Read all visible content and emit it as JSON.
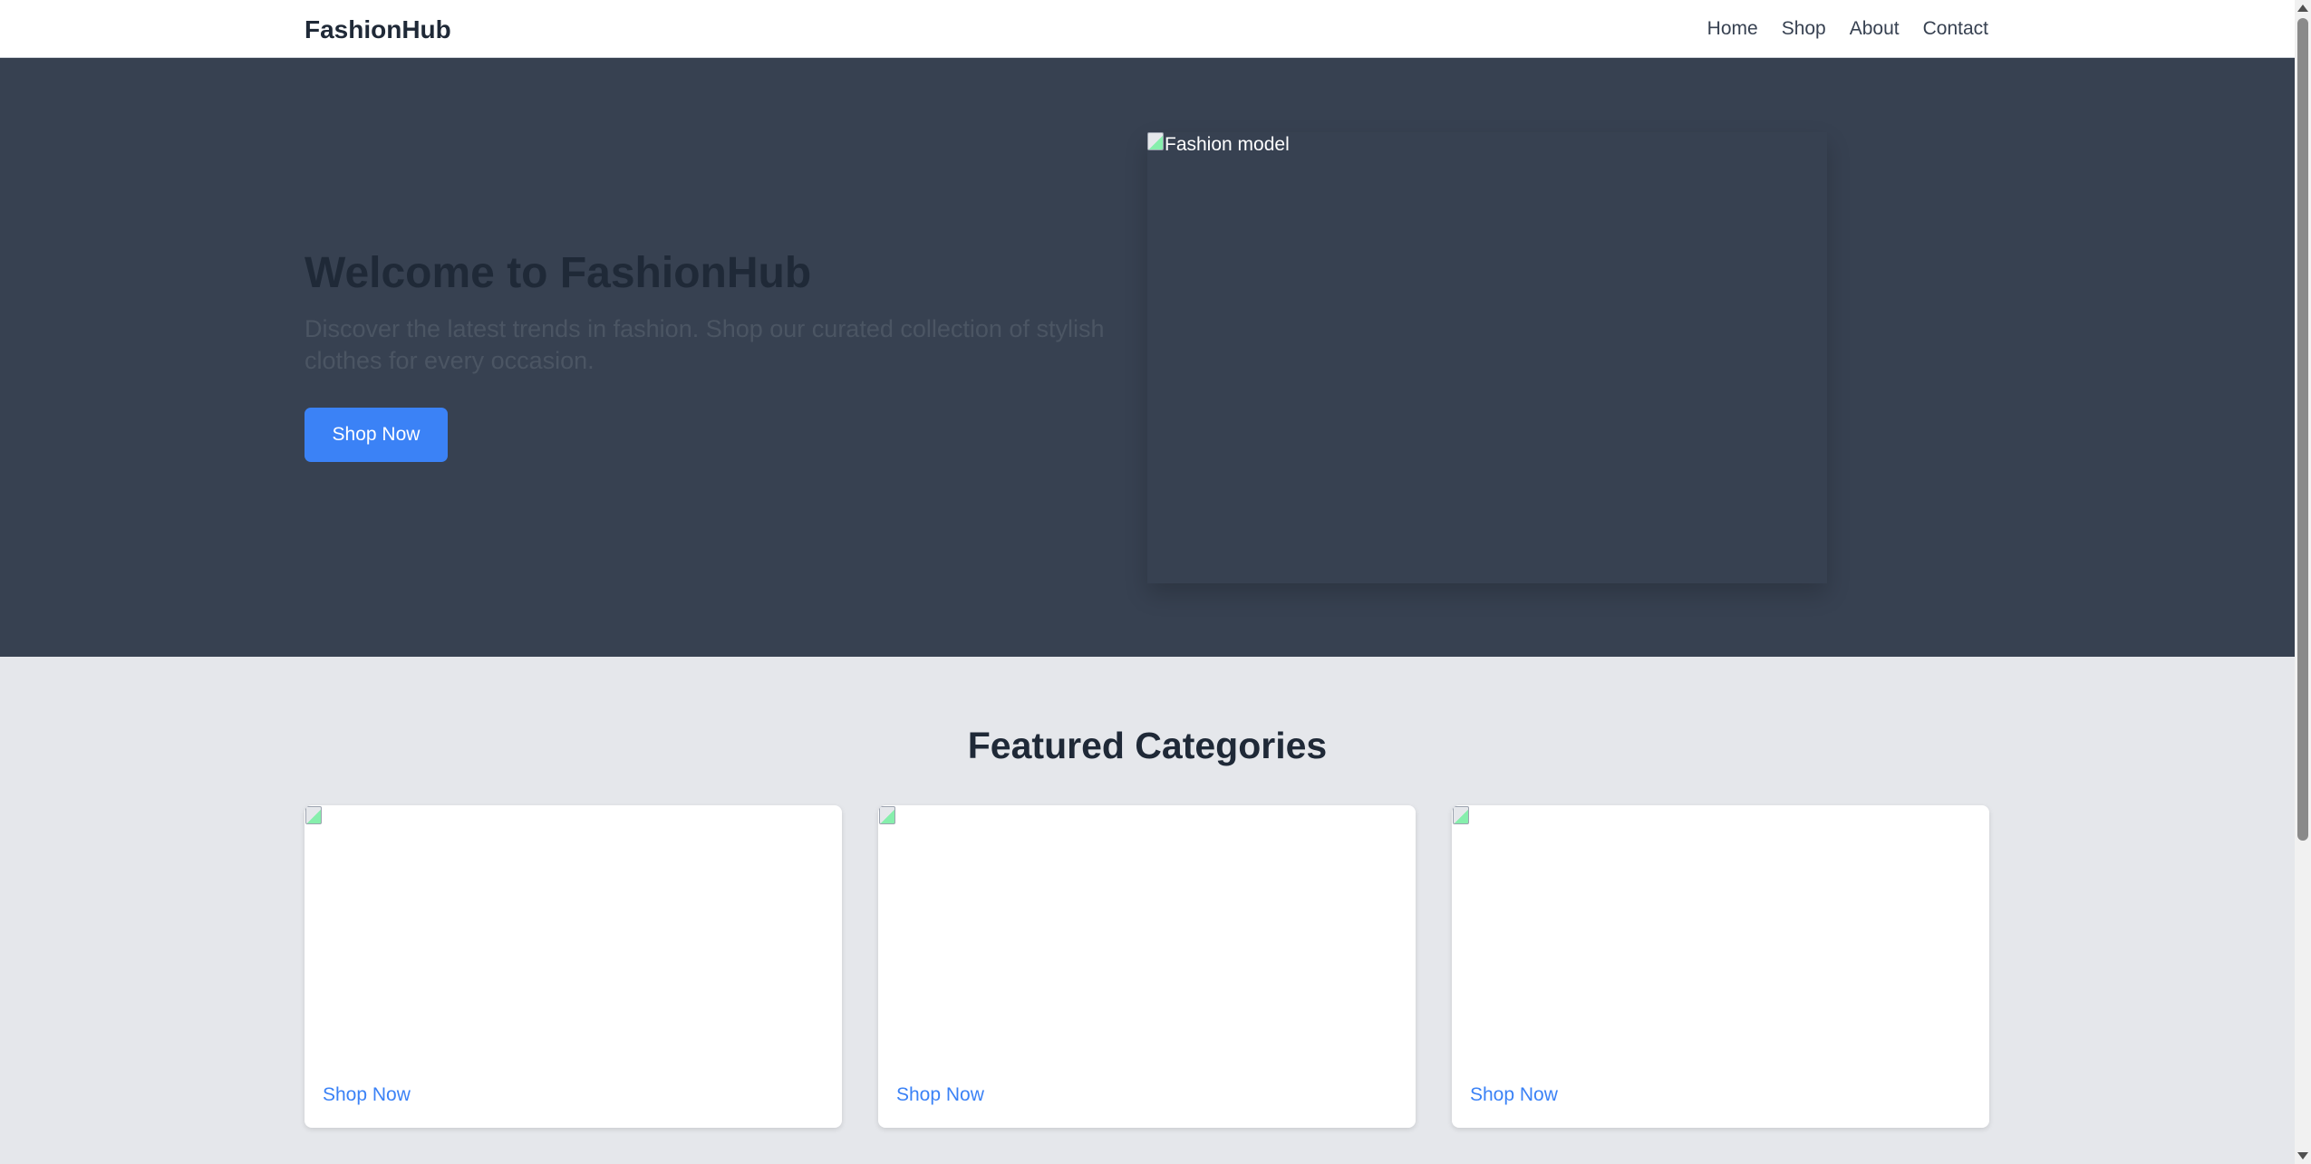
{
  "navbar": {
    "brand": "FashionHub",
    "links": [
      "Home",
      "Shop",
      "About",
      "Contact"
    ]
  },
  "hero": {
    "title": "Welcome to FashionHub",
    "subtitle": "Discover the latest trends in fashion. Shop our curated collection of stylish clothes for every occasion.",
    "button_label": "Shop Now",
    "image_alt": "Fashion model"
  },
  "featured": {
    "title": "Featured Categories",
    "cards": [
      {
        "link_label": "Shop Now"
      },
      {
        "link_label": "Shop Now"
      },
      {
        "link_label": "Shop Now"
      }
    ]
  },
  "colors": {
    "hero_background": "#374151",
    "accent": "#3b82f6",
    "page_background": "#e5e7eb"
  }
}
